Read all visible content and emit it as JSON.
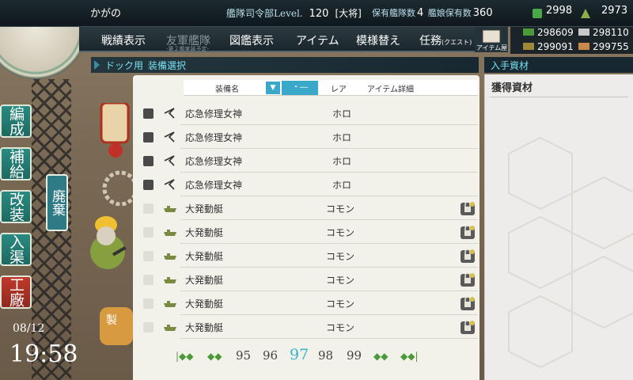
{
  "header": {
    "admiral_name": "かがの",
    "level_label": "艦隊司令部Level.",
    "level": "120",
    "rank": "[大将]",
    "ships_label": "保有艦隊数",
    "ships_value": "4",
    "girls_label": "艦娘保有数",
    "girls_value": "360",
    "bucket": "2998",
    "devmat": "2973"
  },
  "nav": {
    "items": [
      "戦績表示",
      "友軍艦隊",
      "図鑑表示",
      "アイテム",
      "模様替え",
      "任務"
    ],
    "quest_suffix": "(クエスト)",
    "sub_note": "-第２期実装予定-",
    "item_shop": "アイテム屋"
  },
  "resources": {
    "fuel": "298609",
    "ammo": "299091",
    "steel": "298110",
    "bauxite": "299755"
  },
  "breadcrumb": {
    "dock": "ドック用",
    "current": "装備選択",
    "right": "入手資材"
  },
  "list": {
    "col_name": "装備名",
    "col_sort": "▼",
    "col_select": "・―",
    "col_rare": "レア",
    "col_detail": "アイテム詳細",
    "rows": [
      {
        "name": "応急修理女神",
        "rare": "ホロ",
        "checked": true
      },
      {
        "name": "応急修理女神",
        "rare": "ホロ",
        "checked": true
      },
      {
        "name": "応急修理女神",
        "rare": "ホロ",
        "checked": true
      },
      {
        "name": "応急修理女神",
        "rare": "ホロ",
        "checked": true
      },
      {
        "name": "大発動艇",
        "rare": "コモン",
        "checked": false
      },
      {
        "name": "大発動艇",
        "rare": "コモン",
        "checked": false
      },
      {
        "name": "大発動艇",
        "rare": "コモン",
        "checked": false
      },
      {
        "name": "大発動艇",
        "rare": "コモン",
        "checked": false
      },
      {
        "name": "大発動艇",
        "rare": "コモン",
        "checked": false
      },
      {
        "name": "大発動艇",
        "rare": "コモン",
        "checked": false
      }
    ]
  },
  "pager": {
    "pages": [
      "95",
      "96",
      "97",
      "98",
      "99"
    ],
    "current": "97"
  },
  "right_panel": {
    "title": "獲得資材"
  },
  "side": {
    "roundel": "工廠",
    "menu": [
      "編成",
      "補給",
      "改装",
      "入渠",
      "工廠"
    ],
    "select_tab": "廃棄",
    "build_btn": "製"
  },
  "clock": {
    "date": "08/12",
    "time": "19:58"
  }
}
